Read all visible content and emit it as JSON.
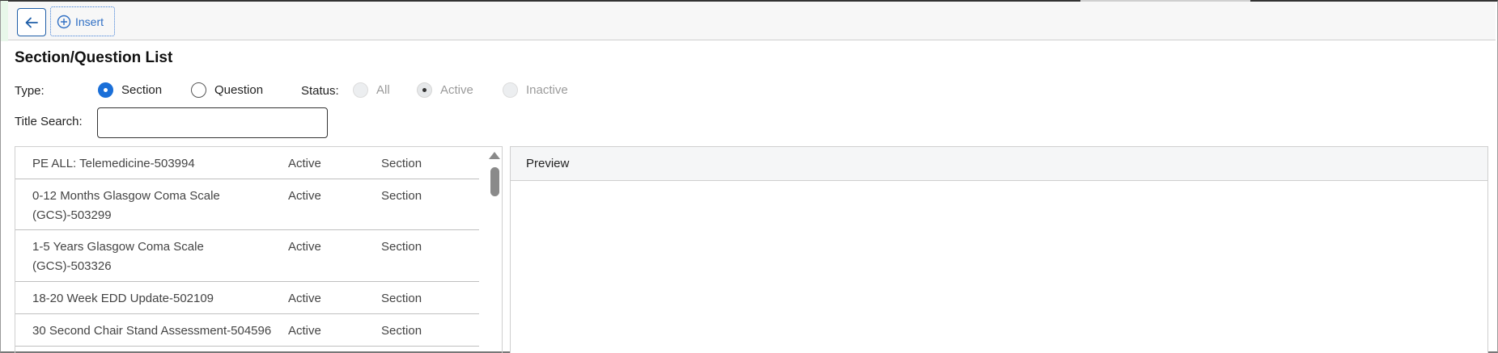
{
  "toolbar": {
    "back_icon": "arrow-left-icon",
    "insert_icon": "plus-circle-icon",
    "insert_label": "Insert"
  },
  "page": {
    "title": "Section/Question List"
  },
  "filters": {
    "type_label": "Type:",
    "type_options": [
      {
        "label": "Section",
        "selected": true
      },
      {
        "label": "Question",
        "selected": false
      }
    ],
    "status_label": "Status:",
    "status_options": [
      {
        "label": "All",
        "selected": false,
        "disabled": true
      },
      {
        "label": "Active",
        "selected": true,
        "disabled": true
      },
      {
        "label": "Inactive",
        "selected": false,
        "disabled": true
      }
    ],
    "title_search_label": "Title Search:",
    "title_search_value": ""
  },
  "list": {
    "rows": [
      {
        "title": "PE ALL: Telemedicine-503994",
        "status": "Active",
        "type": "Section"
      },
      {
        "title": "0-12 Months Glasgow Coma Scale (GCS)-503299",
        "status": "Active",
        "type": "Section"
      },
      {
        "title": "1-5 Years Glasgow Coma Scale (GCS)-503326",
        "status": "Active",
        "type": "Section"
      },
      {
        "title": "18-20 Week EDD Update-502109",
        "status": "Active",
        "type": "Section"
      },
      {
        "title": "30 Second Chair Stand Assessment-504596",
        "status": "Active",
        "type": "Section"
      }
    ]
  },
  "preview": {
    "header": "Preview"
  },
  "colors": {
    "accent": "#1a6fd8",
    "back_button_border": "#1f5ea8",
    "insert_text": "#2f6fc4"
  }
}
